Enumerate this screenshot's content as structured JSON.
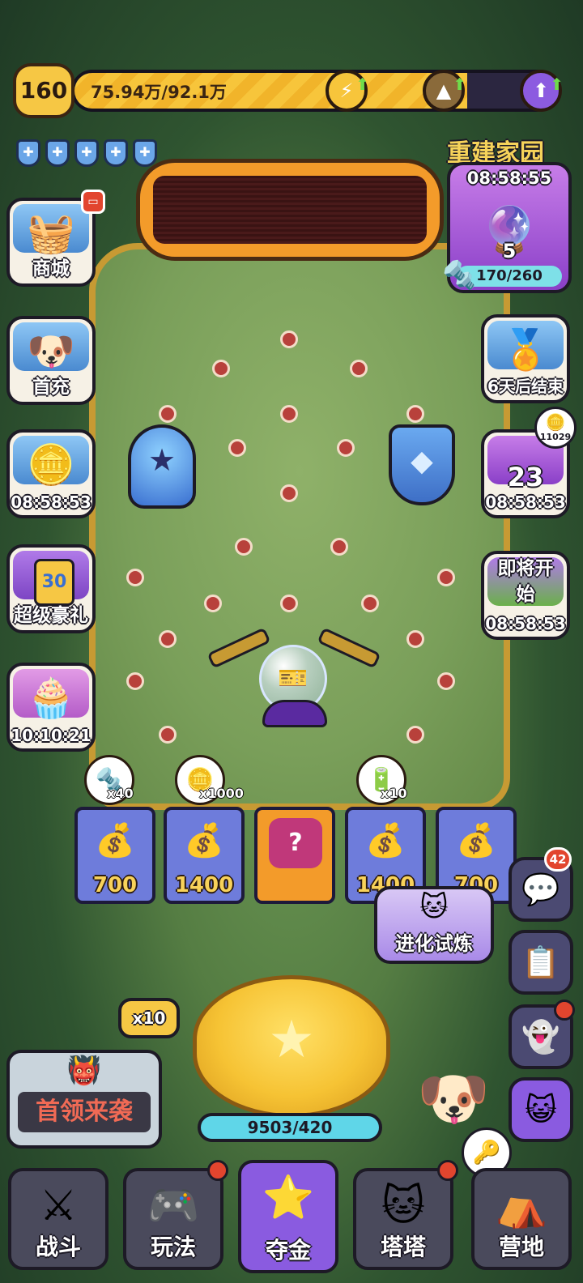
{
  "header": {
    "level": "160",
    "xp_text": "75.94万/92.1万",
    "xp_progress": 0.8246,
    "upgrades": [
      {
        "icon": "lightning-icon",
        "color": "#f7c53b"
      },
      {
        "icon": "mountain-icon",
        "color": "#8a6a3a"
      },
      {
        "icon": "up-arrow-icon",
        "color": "#8c5be0"
      }
    ],
    "shield_count": 5
  },
  "left_panel": {
    "shop": {
      "label": "商城"
    },
    "first_recharge": {
      "label": "首充"
    },
    "coin_event": {
      "timer": "08:58:53"
    },
    "super_gift": {
      "label": "超级豪礼",
      "badge": "30"
    },
    "cupcake_event": {
      "timer": "10:10:21"
    }
  },
  "right_panel": {
    "rebuild": {
      "title": "重建家园",
      "timer": "08:58:55",
      "count": "5",
      "progress": "170/260"
    },
    "event_end": {
      "label": "6天后结束"
    },
    "trophy": {
      "badge": "11029",
      "count": "23",
      "timer": "08:58:53"
    },
    "coming_soon": {
      "label": "即将开始",
      "timer": "08:58:53"
    }
  },
  "bins": [
    {
      "value": "700",
      "multiplier": "x40",
      "reward_icon": "screw-icon"
    },
    {
      "value": "1400",
      "multiplier": "x1000",
      "reward_icon": "coin-icon"
    },
    {
      "value": "",
      "mystery": "?",
      "reward_icon": "mystery-star-icon"
    },
    {
      "value": "1400",
      "multiplier": "x10",
      "reward_icon": "battery-icon"
    },
    {
      "value": "700",
      "reward_icon": "coin-pile-icon"
    }
  ],
  "evolution": {
    "label": "进化试炼"
  },
  "chat": {
    "badge": "42"
  },
  "launcher": {
    "multiplier": "x10",
    "counter": "9503/420"
  },
  "boss": {
    "label": "首领来袭"
  },
  "nav": [
    {
      "label": "战斗",
      "icon": "swords-icon",
      "dot": false
    },
    {
      "label": "玩法",
      "icon": "gamepad-icon",
      "dot": true
    },
    {
      "label": "夺金",
      "icon": "faces-icon",
      "dot": false
    },
    {
      "label": "塔塔",
      "icon": "robot-cat-icon",
      "dot": true
    },
    {
      "label": "营地",
      "icon": "tent-icon",
      "dot": false
    }
  ]
}
